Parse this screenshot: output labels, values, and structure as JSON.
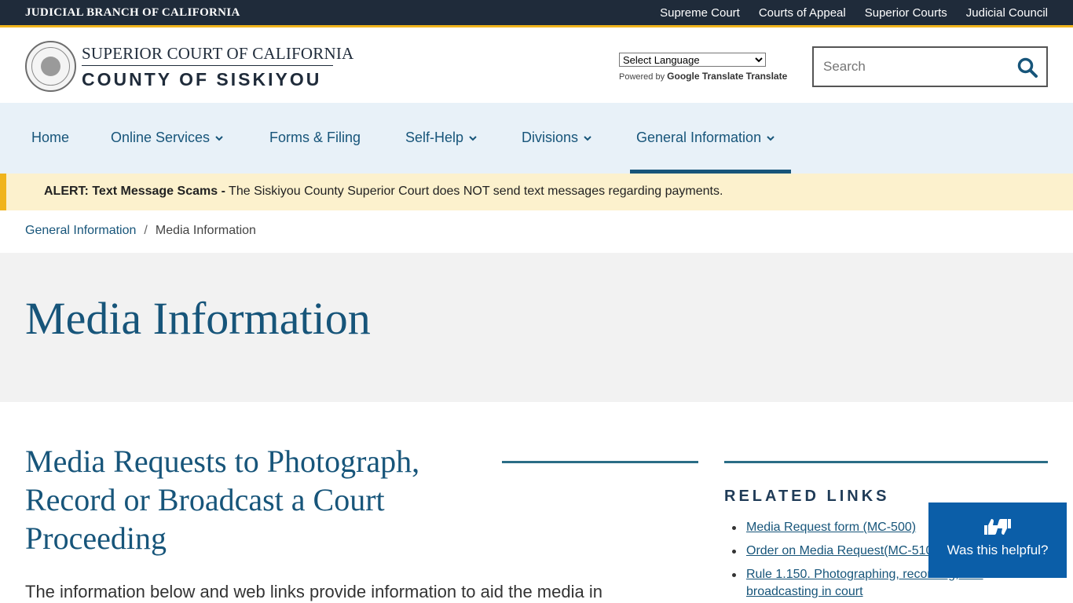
{
  "topbar": {
    "brand": "JUDICIAL BRANCH OF CALIFORNIA",
    "links": [
      "Supreme Court",
      "Courts of Appeal",
      "Superior Courts",
      "Judicial Council"
    ]
  },
  "header": {
    "court_line1": "SUPERIOR COURT OF CALIFORNIA",
    "court_line2": "COUNTY OF SISKIYOU",
    "language_select": "Select Language",
    "powered_by": "Powered by",
    "translate_text": "Google Translate",
    "translate_link": "Translate",
    "search_placeholder": "Search"
  },
  "nav": {
    "items": [
      "Home",
      "Online Services",
      "Forms & Filing",
      "Self-Help",
      "Divisions",
      "General Information"
    ],
    "active": "General Information"
  },
  "alert": {
    "label": "ALERT: Text Message Scams -",
    "message": " The Siskiyou County Superior Court does NOT send text messages regarding payments."
  },
  "breadcrumb": {
    "parent": "General Information",
    "separator": "/",
    "current": "Media Information"
  },
  "hero": {
    "title": "Media Information"
  },
  "content": {
    "section_title": "Media Requests to Photograph, Record or Broadcast a Court Proceeding",
    "intro": "The information below and web links provide information to aid the media in"
  },
  "related": {
    "title": "RELATED LINKS",
    "links": [
      "Media Request form (MC-500)",
      "Order on Media Request(MC-510)",
      "Rule 1.150. Photographing, recording, and broadcasting in court"
    ]
  },
  "feedback": {
    "label": "Was this helpful?"
  },
  "colors": {
    "topbar": "#1f2b3a",
    "accent": "#f0b41c",
    "link": "#17557a",
    "nav_bg": "#e8f1f8",
    "alert_bg": "#fcf1cd",
    "feedback_bg": "#0b5ea8"
  }
}
